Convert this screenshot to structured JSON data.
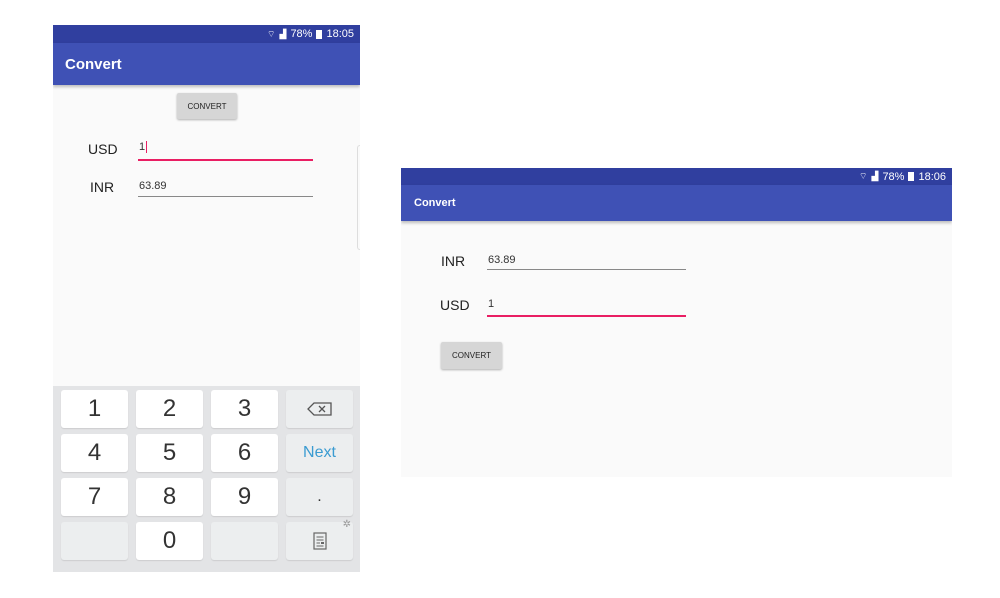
{
  "phone": {
    "status": {
      "signal_icon": "wifi-icon",
      "battery": "78%",
      "time": "18:05"
    },
    "app_title": "Convert",
    "convert_button": "CONVERT",
    "rows": [
      {
        "label": "USD",
        "value": "1"
      },
      {
        "label": "INR",
        "value": "63.89"
      }
    ],
    "keyboard": {
      "keys": [
        "1",
        "2",
        "3",
        "4",
        "5",
        "6",
        "7",
        "8",
        "9",
        "0"
      ],
      "next": "Next",
      "dot": "."
    }
  },
  "tablet": {
    "status": {
      "battery": "78%",
      "time": "18:06"
    },
    "app_title": "Convert",
    "rows": [
      {
        "label": "INR",
        "value": "63.89"
      },
      {
        "label": "USD",
        "value": "1"
      }
    ],
    "convert_button": "CONVERT"
  },
  "colors": {
    "primary": "#3f51b5",
    "primary_dark": "#303f9f",
    "accent": "#e91e63"
  }
}
